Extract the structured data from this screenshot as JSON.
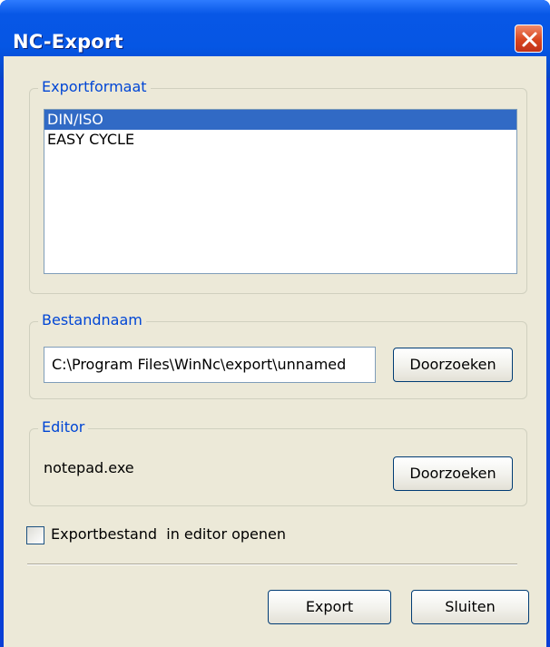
{
  "window": {
    "title": "NC-Export"
  },
  "export_format": {
    "label": "Exportformaat",
    "items": [
      "DIN/ISO",
      "EASY CYCLE"
    ],
    "selected_index": 0
  },
  "filename": {
    "label": "Bestandnaam",
    "value": "C:\\Program Files\\WinNc\\export\\unnamed",
    "browse_label": "Doorzoeken"
  },
  "editor": {
    "label": "Editor",
    "value": "notepad.exe",
    "browse_label": "Doorzoeken"
  },
  "open_in_editor": {
    "label": "Exportbestand  in editor openen",
    "checked": false
  },
  "buttons": {
    "export": "Export",
    "close": "Sluiten"
  },
  "colors": {
    "titlebar": "#0556e4",
    "selection": "#316ac5",
    "group_label": "#0046d5",
    "close_button": "#d8461f"
  }
}
